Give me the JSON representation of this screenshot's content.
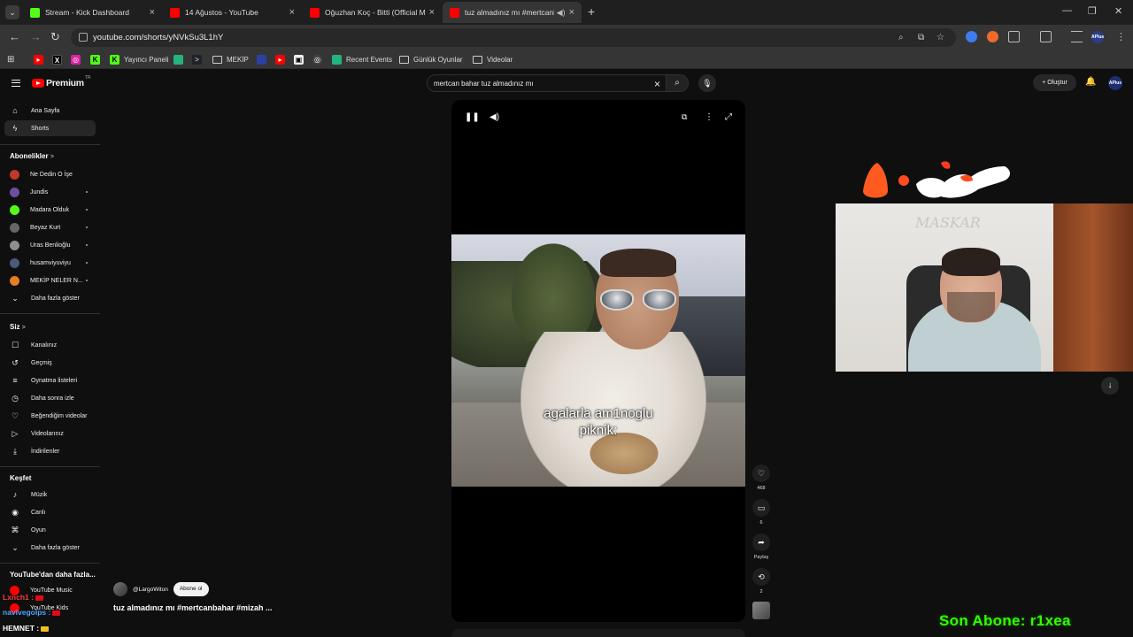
{
  "browser": {
    "tabs": [
      {
        "title": "Stream - Kick Dashboard",
        "color": "#53fc18",
        "active": false
      },
      {
        "title": "14 Ağustos - YouTube",
        "color": "#ff0000",
        "active": false
      },
      {
        "title": "Oğuzhan Koç - Bitti (Official M",
        "color": "#ff0000",
        "active": false
      },
      {
        "title": "tuz almadınız mı #mertcanb",
        "color": "#ff0000",
        "active": true
      }
    ],
    "url": "youtube.com/shorts/yNVkSu3L1hY",
    "profile_label": "APlus",
    "bookmarks": [
      {
        "label": "Yayıncı Paneli",
        "icon": "kick",
        "color": "#53fc18"
      },
      {
        "label": "MEKİP",
        "icon": "folder"
      },
      {
        "label": "Recent Events",
        "icon": "streamelements",
        "color": "#24b47e"
      },
      {
        "label": "Günlük Oyunlar",
        "icon": "folder"
      },
      {
        "label": "Videolar",
        "icon": "folder"
      }
    ]
  },
  "youtube": {
    "logo": "Premium",
    "region": "TR",
    "search_query": "mertcan bahar tuz almadınız mı",
    "create_label": "Oluştur",
    "avatar_label": "APlus",
    "sidebar": {
      "main": [
        {
          "label": "Ana Sayfa",
          "icon": "home-icon",
          "glyph": "⌂"
        },
        {
          "label": "Shorts",
          "icon": "shorts-icon",
          "glyph": "ϟ"
        }
      ],
      "subscriptions_heading": "Abonelikler",
      "subscriptions": [
        {
          "label": "Ne Dedin O İşe",
          "color": "#c0392b",
          "dot": false
        },
        {
          "label": "Jundis",
          "color": "#6b4fa0",
          "dot": true
        },
        {
          "label": "Madara Olduk",
          "color": "#53fc18",
          "dot": true
        },
        {
          "label": "Beyaz Kurt",
          "color": "#666666",
          "dot": true
        },
        {
          "label": "Uras Benlioğlu",
          "color": "#8e8e8e",
          "dot": true
        },
        {
          "label": "husamviyuviyu",
          "color": "#4a5a7a",
          "dot": true
        },
        {
          "label": "MEKİP NELER N...",
          "color": "#e67e22",
          "dot": true
        }
      ],
      "show_more": "Daha fazla göster",
      "you_heading": "Siz",
      "you": [
        {
          "label": "Kanalınız",
          "icon": "channel-icon",
          "glyph": "☐"
        },
        {
          "label": "Geçmiş",
          "icon": "history-icon",
          "glyph": "↺"
        },
        {
          "label": "Oynatma listeleri",
          "icon": "playlists-icon",
          "glyph": "≡"
        },
        {
          "label": "Daha sonra izle",
          "icon": "watch-later-icon",
          "glyph": "◷"
        },
        {
          "label": "Beğendiğim videolar",
          "icon": "liked-icon",
          "glyph": "♡"
        },
        {
          "label": "Videolarınız",
          "icon": "your-videos-icon",
          "glyph": "▷"
        },
        {
          "label": "İndirilenler",
          "icon": "downloads-icon",
          "glyph": "⤓"
        }
      ],
      "explore_heading": "Keşfet",
      "explore": [
        {
          "label": "Müzik",
          "icon": "music-icon",
          "glyph": "♪"
        },
        {
          "label": "Canlı",
          "icon": "live-icon",
          "glyph": "◉"
        },
        {
          "label": "Oyun",
          "icon": "gaming-icon",
          "glyph": "⌘"
        }
      ],
      "show_more2": "Daha fazla göster",
      "more_heading": "YouTube'dan daha fazla...",
      "more": [
        {
          "label": "YouTube Music"
        },
        {
          "label": "YouTube Kids"
        }
      ]
    },
    "short": {
      "caption_line1": "agalarla am1noglu",
      "caption_line2": "piknik:",
      "likes": "468",
      "comments": "6",
      "share_label": "Paylaş",
      "remix": "2",
      "channel": "@LargoWiton",
      "subscribe_label": "Abone ol",
      "title": "tuz almadınız mı  #mertcanbahar #mizah ..."
    }
  },
  "overlay": {
    "webcam_sign": "MASKAR",
    "last_sub": "Son Abone: r1xea",
    "sub_color": "#33ff00",
    "chat": [
      {
        "user": "Lxnch1 :",
        "color": "#ff3b3b"
      },
      {
        "user": "navivegolps :",
        "color": "#4da6ff"
      },
      {
        "user": "HEMNET :",
        "color": "#ffffff"
      }
    ]
  }
}
